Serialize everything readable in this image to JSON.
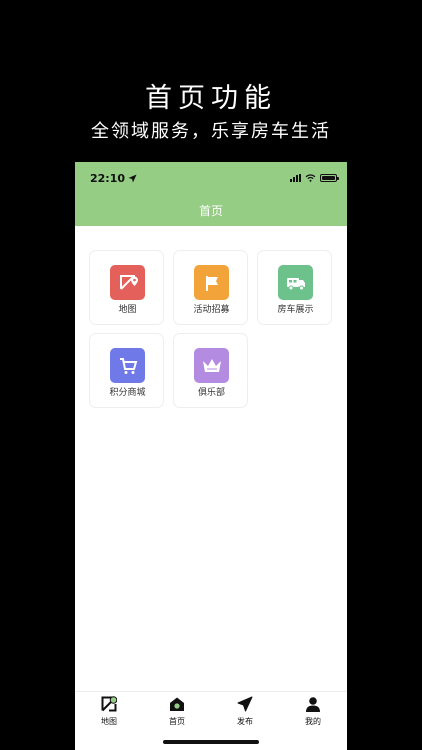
{
  "promo": {
    "title": "首页功能",
    "subtitle": "全领域服务，乐享房车生活"
  },
  "status_bar": {
    "time": "22:10",
    "icons": [
      "location-arrow-icon",
      "cellular-signal-icon",
      "wifi-icon",
      "battery-icon"
    ]
  },
  "header": {
    "title": "首页"
  },
  "features": [
    {
      "label": "地图",
      "icon": "map-pin-icon",
      "color": "#e4605a"
    },
    {
      "label": "活动招募",
      "icon": "flag-icon",
      "color": "#f2a43a"
    },
    {
      "label": "房车展示",
      "icon": "rv-truck-icon",
      "color": "#6cc28a"
    },
    {
      "label": "积分商城",
      "icon": "shopping-cart-icon",
      "color": "#6f79e8"
    },
    {
      "label": "俱乐部",
      "icon": "crown-icon",
      "color": "#b38be0"
    }
  ],
  "tab_bar": {
    "items": [
      {
        "label": "地图",
        "icon": "map-icon"
      },
      {
        "label": "首页",
        "icon": "home-icon",
        "active": true
      },
      {
        "label": "发布",
        "icon": "send-icon"
      },
      {
        "label": "我的",
        "icon": "profile-icon"
      }
    ]
  },
  "colors": {
    "header_green": "#95cd85",
    "background": "#000000"
  }
}
